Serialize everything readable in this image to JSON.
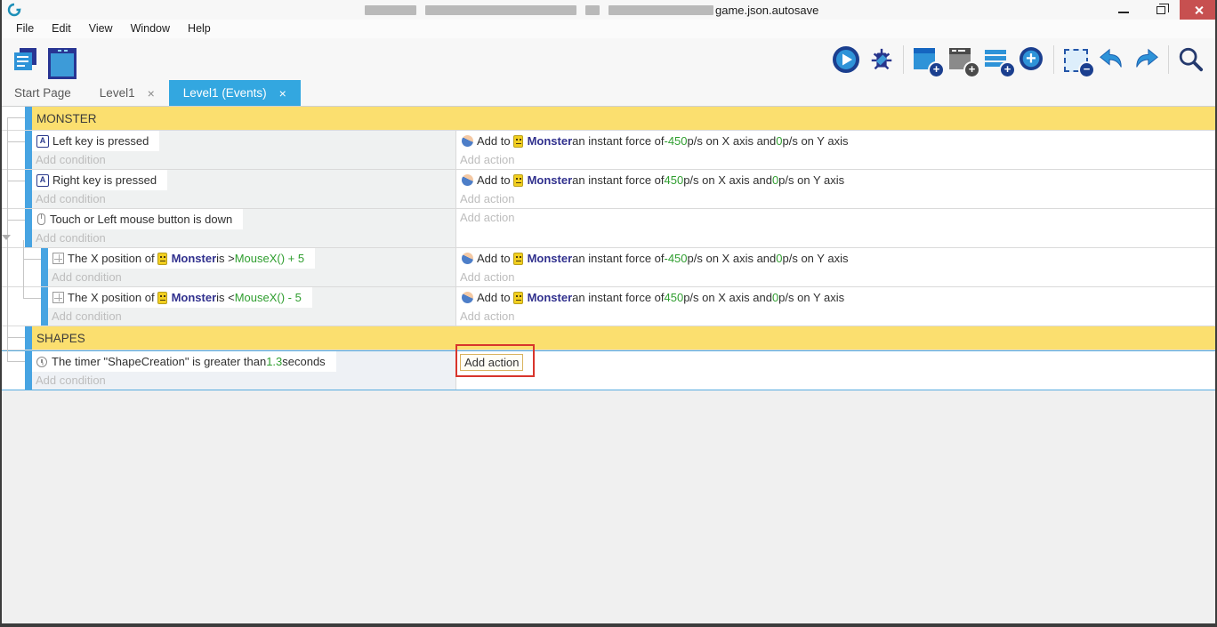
{
  "window": {
    "title_visible": "game.json.autosave",
    "controls": [
      "minimize",
      "restore",
      "close"
    ]
  },
  "menu": {
    "items": [
      "File",
      "Edit",
      "View",
      "Window",
      "Help"
    ]
  },
  "toolbar": {
    "left_groups": [
      [
        "open-project",
        "scene-editor"
      ]
    ],
    "right_groups": [
      [
        "preview-play",
        "debug"
      ],
      [
        "add-event",
        "add-subevent",
        "add-comment",
        "add-special-event"
      ],
      [
        "toggle-disable",
        "undo",
        "redo"
      ],
      [
        "search"
      ]
    ]
  },
  "tabs": {
    "close_glyph": "×",
    "items": [
      {
        "label": "Start Page",
        "closable": false,
        "active": false
      },
      {
        "label": "Level1",
        "closable": true,
        "active": false
      },
      {
        "label": "Level1 (Events)",
        "closable": true,
        "active": true
      }
    ]
  },
  "placeholders": {
    "condition": "Add condition",
    "action": "Add action"
  },
  "colors": {
    "comment_yellow": "#fbdf6f",
    "event_bar_blue": "#47a4e2",
    "active_tab_blue": "#33a7e0",
    "value_green": "#2f9e2f",
    "object_navy": "#31318e",
    "selection_border": "#57abdf",
    "annotation_red": "#d8352c",
    "close_button_red": "#c75050"
  },
  "events": [
    {
      "type": "comment",
      "label": "MONSTER"
    },
    {
      "type": "event",
      "indent": 0,
      "conditions": [
        [
          {
            "icon": "keyboard"
          },
          {
            "t": "Left key is pressed"
          }
        ]
      ],
      "actions": [
        [
          {
            "icon": "force"
          },
          {
            "t": "Add to "
          },
          {
            "icon": "monster"
          },
          {
            "t": "Monster",
            "s": "object"
          },
          {
            "t": " an instant force of "
          },
          {
            "t": "-450",
            "s": "value"
          },
          {
            "t": " p/s on X axis and "
          },
          {
            "t": "0",
            "s": "value"
          },
          {
            "t": " p/s on Y axis"
          }
        ]
      ]
    },
    {
      "type": "event",
      "indent": 0,
      "conditions": [
        [
          {
            "icon": "keyboard"
          },
          {
            "t": "Right key is pressed"
          }
        ]
      ],
      "actions": [
        [
          {
            "icon": "force"
          },
          {
            "t": "Add to "
          },
          {
            "icon": "monster"
          },
          {
            "t": "Monster",
            "s": "object"
          },
          {
            "t": " an instant force of "
          },
          {
            "t": "450",
            "s": "value"
          },
          {
            "t": " p/s on X axis and "
          },
          {
            "t": "0",
            "s": "value"
          },
          {
            "t": " p/s on Y axis"
          }
        ]
      ]
    },
    {
      "type": "event",
      "indent": 0,
      "collapser": true,
      "conditions": [
        [
          {
            "icon": "mouse"
          },
          {
            "t": "Touch or Left mouse button is down"
          }
        ]
      ],
      "actions": []
    },
    {
      "type": "event",
      "indent": 1,
      "conditions": [
        [
          {
            "icon": "position"
          },
          {
            "t": "The X position of "
          },
          {
            "icon": "monster"
          },
          {
            "t": "Monster",
            "s": "object"
          },
          {
            "t": " is > "
          },
          {
            "t": "MouseX() + 5",
            "s": "value"
          }
        ]
      ],
      "actions": [
        [
          {
            "icon": "force"
          },
          {
            "t": "Add to "
          },
          {
            "icon": "monster"
          },
          {
            "t": "Monster",
            "s": "object"
          },
          {
            "t": " an instant force of "
          },
          {
            "t": "-450",
            "s": "value"
          },
          {
            "t": " p/s on X axis and "
          },
          {
            "t": "0",
            "s": "value"
          },
          {
            "t": " p/s on Y axis"
          }
        ]
      ]
    },
    {
      "type": "event",
      "indent": 1,
      "conditions": [
        [
          {
            "icon": "position"
          },
          {
            "t": "The X position of "
          },
          {
            "icon": "monster"
          },
          {
            "t": "Monster",
            "s": "object"
          },
          {
            "t": " is < "
          },
          {
            "t": "MouseX() - 5",
            "s": "value"
          }
        ]
      ],
      "actions": [
        [
          {
            "icon": "force"
          },
          {
            "t": "Add to "
          },
          {
            "icon": "monster"
          },
          {
            "t": "Monster",
            "s": "object"
          },
          {
            "t": " an instant force of "
          },
          {
            "t": "450",
            "s": "value"
          },
          {
            "t": " p/s on X axis and "
          },
          {
            "t": "0",
            "s": "value"
          },
          {
            "t": " p/s on Y axis"
          }
        ]
      ]
    },
    {
      "type": "comment",
      "label": "SHAPES"
    },
    {
      "type": "event",
      "indent": 0,
      "selected": true,
      "action_focused": true,
      "annotated": true,
      "conditions": [
        [
          {
            "icon": "timer"
          },
          {
            "t": "The timer \"ShapeCreation\" is greater than "
          },
          {
            "t": "1.3",
            "s": "value"
          },
          {
            "t": " seconds"
          }
        ]
      ],
      "actions": []
    }
  ]
}
